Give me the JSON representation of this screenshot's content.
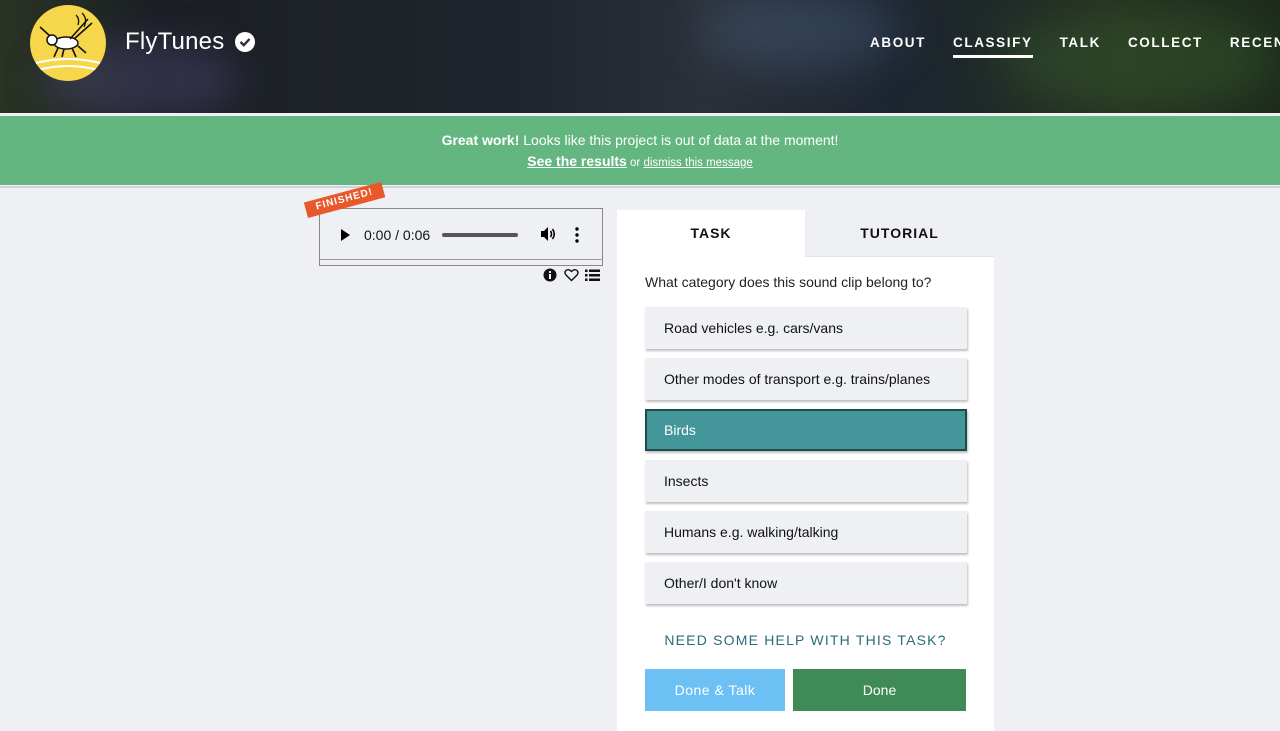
{
  "header": {
    "brand": "FlyTunes",
    "nav": [
      "ABOUT",
      "CLASSIFY",
      "TALK",
      "COLLECT",
      "RECENTS"
    ],
    "active_nav": "CLASSIFY"
  },
  "banner": {
    "bold": "Great work!",
    "message": " Looks like this project is out of data at the moment!",
    "results_link": "See the results",
    "or_text": " or ",
    "dismiss_link": "dismiss this message"
  },
  "player": {
    "ribbon": "FINISHED!",
    "time": "0:00 / 0:06"
  },
  "tabs": {
    "task": "TASK",
    "tutorial": "TUTORIAL"
  },
  "question": "What category does this sound clip belong to?",
  "answers": [
    "Road vehicles e.g. cars/vans",
    "Other modes of transport e.g. trains/planes",
    "Birds",
    "Insects",
    "Humans e.g. walking/talking",
    "Other/I don't know"
  ],
  "selected_answer": "Birds",
  "help": "NEED SOME HELP WITH THIS TASK?",
  "buttons": {
    "done_talk": "Done & Talk",
    "done": "Done"
  },
  "colors": {
    "banner": "#64b680",
    "selected": "#43969a",
    "done": "#3f8a56",
    "done_talk": "#6cc0f4",
    "ribbon": "#e8582a"
  },
  "icons": [
    "play-icon",
    "volume-icon",
    "more-options-icon",
    "info-icon",
    "heart-icon",
    "list-icon",
    "verified-icon"
  ]
}
